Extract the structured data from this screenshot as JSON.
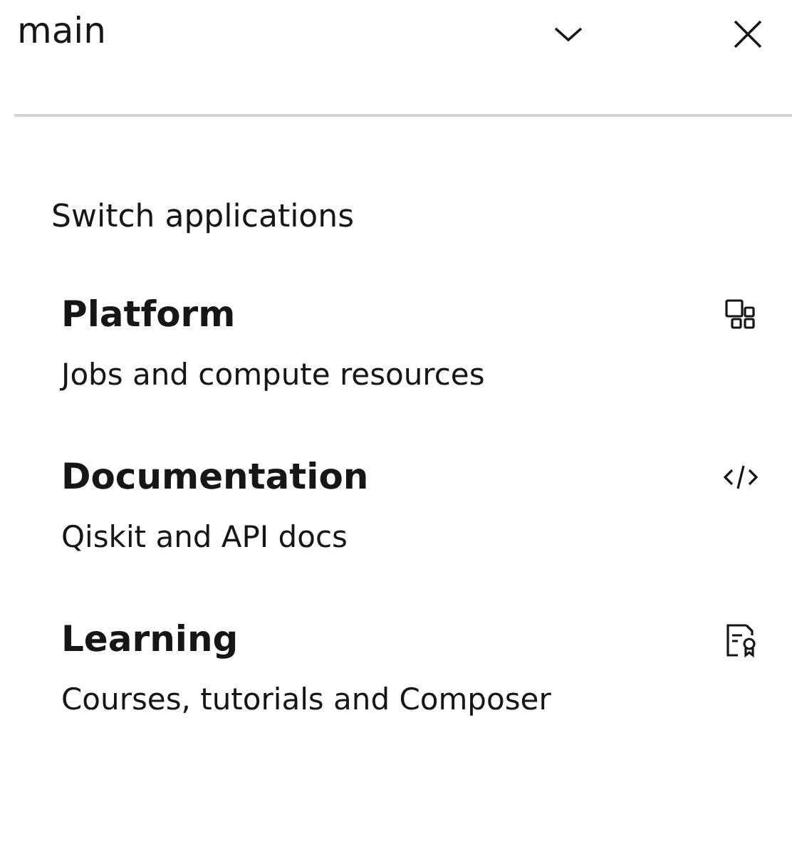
{
  "header": {
    "value": "main"
  },
  "section_title": "Switch applications",
  "apps": [
    {
      "title": "Platform",
      "description": "Jobs and compute resources",
      "kind": "apps"
    },
    {
      "title": "Documentation",
      "description": "Qiskit and API docs",
      "kind": "code"
    },
    {
      "title": "Learning",
      "description": "Courses, tutorials and Composer",
      "kind": "certificate"
    }
  ]
}
